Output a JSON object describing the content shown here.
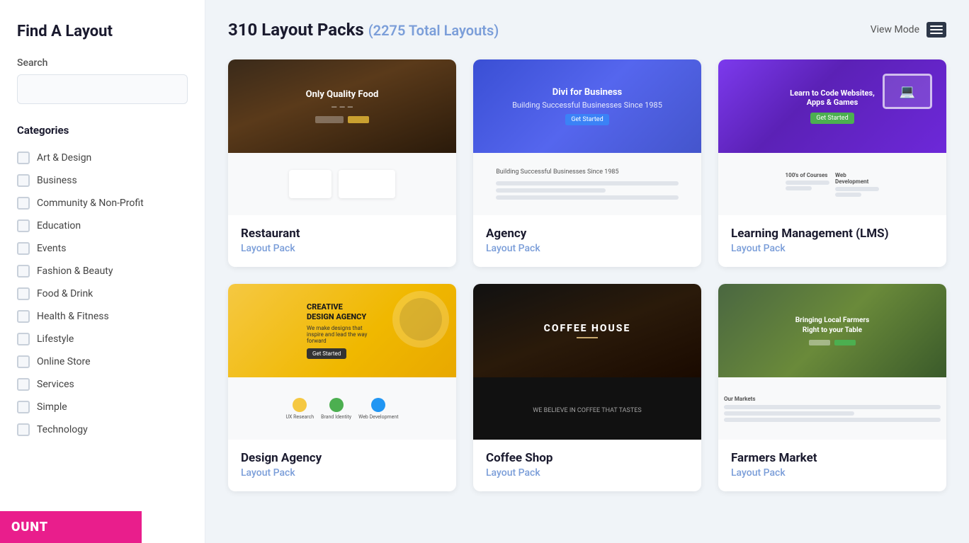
{
  "sidebar": {
    "title": "Find A Layout",
    "search": {
      "label": "Search",
      "placeholder": ""
    },
    "categories_title": "Categories",
    "categories": [
      {
        "id": "art-design",
        "label": "Art & Design",
        "checked": false
      },
      {
        "id": "business",
        "label": "Business",
        "checked": false
      },
      {
        "id": "community-non-profit",
        "label": "Community & Non-Profit",
        "checked": false
      },
      {
        "id": "education",
        "label": "Education",
        "checked": false
      },
      {
        "id": "events",
        "label": "Events",
        "checked": false
      },
      {
        "id": "fashion-beauty",
        "label": "Fashion & Beauty",
        "checked": false
      },
      {
        "id": "food-drink",
        "label": "Food & Drink",
        "checked": false
      },
      {
        "id": "health-fitness",
        "label": "Health & Fitness",
        "checked": false
      },
      {
        "id": "lifestyle",
        "label": "Lifestyle",
        "checked": false
      },
      {
        "id": "online-store",
        "label": "Online Store",
        "checked": false
      },
      {
        "id": "services",
        "label": "Services",
        "checked": false
      },
      {
        "id": "simple",
        "label": "Simple",
        "checked": false
      },
      {
        "id": "technology",
        "label": "Technology",
        "checked": false
      }
    ]
  },
  "header": {
    "title": "310 Layout Packs",
    "count_label": "(2275 Total Layouts)",
    "view_mode_label": "View Mode"
  },
  "layout_packs": [
    {
      "id": "restaurant",
      "title": "Restaurant",
      "subtitle": "Layout Pack",
      "type": "restaurant"
    },
    {
      "id": "agency",
      "title": "Agency",
      "subtitle": "Layout Pack",
      "type": "agency"
    },
    {
      "id": "lms",
      "title": "Learning Management (LMS)",
      "subtitle": "Layout Pack",
      "type": "lms"
    },
    {
      "id": "design-agency",
      "title": "Design Agency",
      "subtitle": "Layout Pack",
      "type": "design"
    },
    {
      "id": "coffee-shop",
      "title": "Coffee Shop",
      "subtitle": "Layout Pack",
      "type": "coffee"
    },
    {
      "id": "farmers-market",
      "title": "Farmers Market",
      "subtitle": "Layout Pack",
      "type": "farmers"
    }
  ],
  "discount": {
    "label": "OUNT"
  }
}
